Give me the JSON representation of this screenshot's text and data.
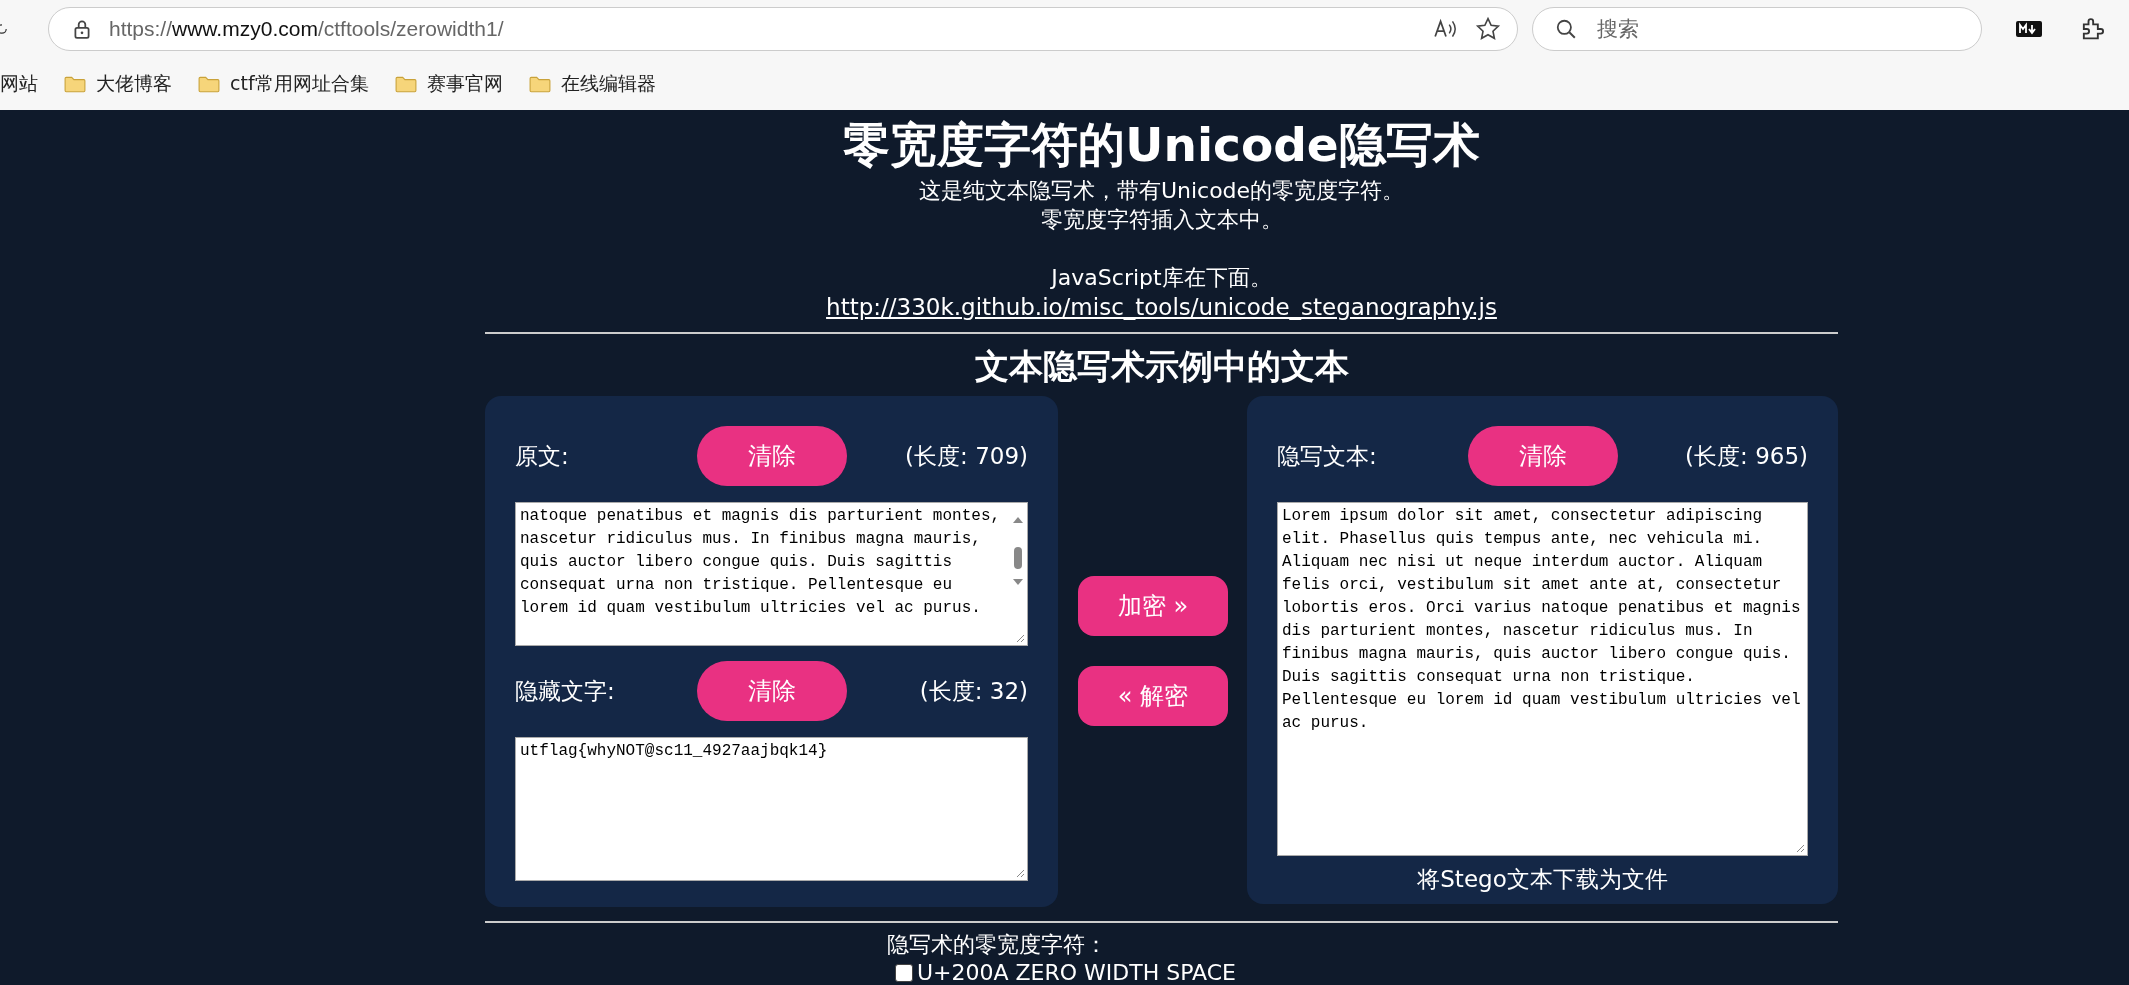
{
  "browser": {
    "url": {
      "scheme": "https://",
      "host": "www.mzy0.com",
      "path": "/ctftools/zerowidth1/"
    },
    "search": {
      "placeholder": "搜索"
    },
    "bookmarks": [
      {
        "label": "网站",
        "folder": false
      },
      {
        "label": "大佬博客",
        "folder": true
      },
      {
        "label": "ctf常用网址合集",
        "folder": true
      },
      {
        "label": "赛事官网",
        "folder": true
      },
      {
        "label": "在线编辑器",
        "folder": true
      }
    ]
  },
  "header": {
    "title": "零宽度字符的Unicode隐写术",
    "lines": [
      "这是纯文本隐写术，带有Unicode的零宽度字符。",
      "零宽度字符插入文本中。"
    ],
    "library_note": "JavaScript库在下面。",
    "library_link": "http://330k.github.io/misc_tools/unicode_steganography.js"
  },
  "section_title": "文本隐写术示例中的文本",
  "left_panel": [
    {
      "label": "原文:",
      "clear_button": "清除",
      "length": "(长度: 709)",
      "text": "natoque penatibus et magnis dis parturient montes, nascetur ridiculus mus. In finibus magna mauris, quis auctor libero congue quis. Duis sagittis consequat urna non tristique. Pellentesque eu lorem id quam vestibulum ultricies vel ac purus.",
      "scrollbar": true
    },
    {
      "label": "隐藏文字:",
      "clear_button": "清除",
      "length": "(长度: 32)",
      "text": "utflag{whyNOT@sc11_4927aajbqk14}",
      "scrollbar": false
    }
  ],
  "actions": {
    "encode": "加密 »",
    "decode": "« 解密"
  },
  "right_panel": {
    "label": "隐写文本:",
    "clear_button": "清除",
    "length": "(长度: 965)",
    "text": "Lorem ipsum dolor sit amet, consectetur adipiscing elit. Phasellus quis tempus ante, nec vehicula mi. Aliquam nec nisi ut neque interdum auctor. Aliquam felis orci, vestibulum sit amet ante at, consectetur lobortis eros. Orci varius natoque penatibus et magnis dis parturient montes, nascetur ridiculus mus. In finibus magna mauris, quis auctor libero congue quis. Duis sagittis consequat urna non tristique. Pellentesque eu lorem id quam vestibulum ultricies vel ac purus.",
    "download": "将Stego文本下载为文件"
  },
  "zero_width": {
    "heading": "隐写术的零宽度字符：",
    "options": [
      {
        "label": "U+200A ZERO WIDTH SPACE",
        "checked": false
      }
    ]
  }
}
